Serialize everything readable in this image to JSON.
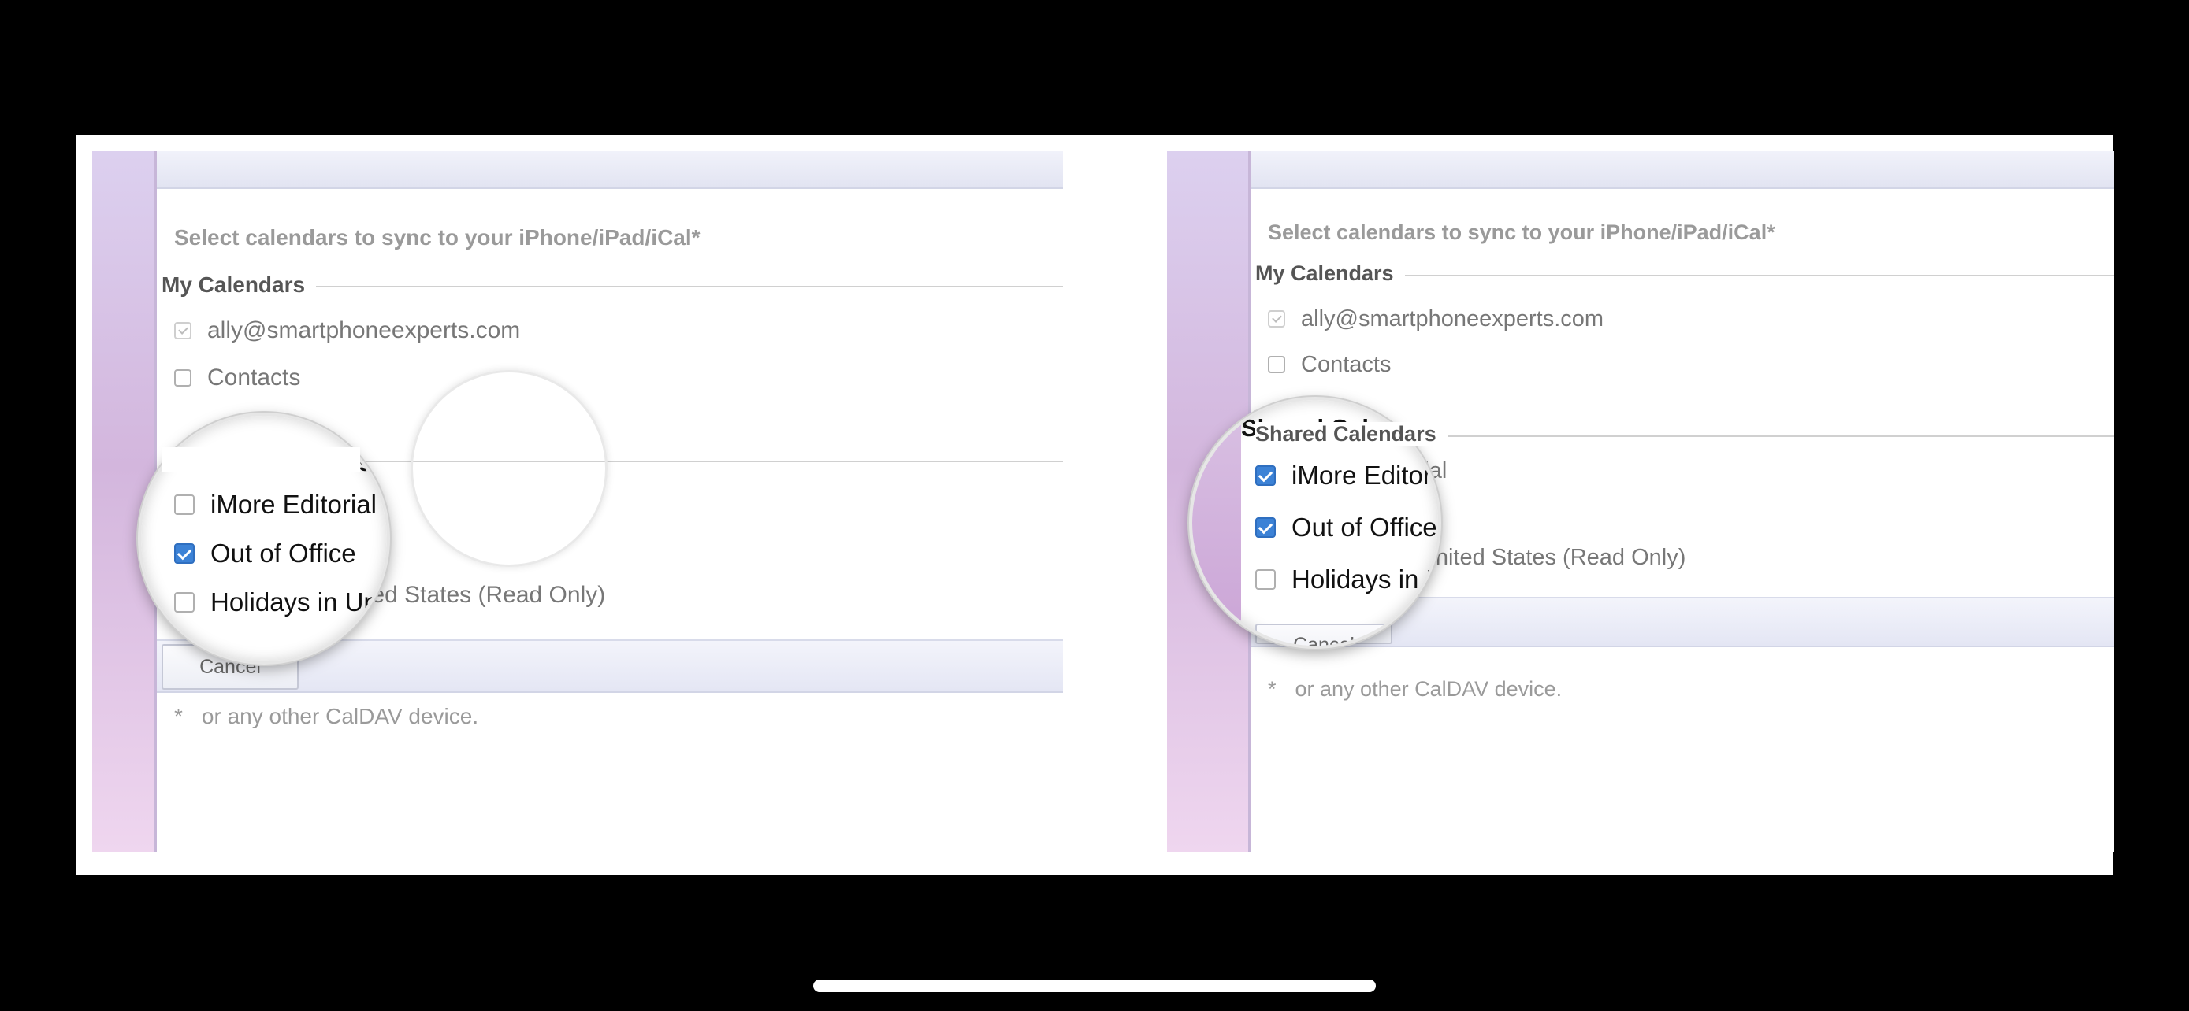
{
  "left_panel": {
    "title": "Select calendars to sync to your iPhone/iPad/iCal*",
    "my_calendars_label": "My Calendars",
    "account_label": "ally@smartphoneexperts.com",
    "contacts_label": "Contacts",
    "shared_calendars_label": "Shared Calendars",
    "shared_items": [
      {
        "label": "iMore Editorial",
        "checked": false
      },
      {
        "label": "Out of Office",
        "checked": true
      },
      {
        "label": "Holidays in United States (Read Only)",
        "checked": false
      }
    ],
    "cancel_label": "Cancel",
    "footnote_star": "*",
    "footnote_text": "or any other CalDAV device."
  },
  "right_panel": {
    "title": "Select calendars to sync to your iPhone/iPad/iCal*",
    "my_calendars_label": "My Calendars",
    "account_label": "ally@smartphoneexperts.com",
    "contacts_label": "Contacts",
    "shared_calendars_label": "Shared Calendars",
    "shared_items": [
      {
        "label": "iMore Editorial",
        "checked": true
      },
      {
        "label": "Out of Office",
        "checked": true
      },
      {
        "label": "Holidays in United States (Read Only)",
        "checked": false
      }
    ],
    "cancel_label": "Cancel",
    "footnote_star": "*",
    "footnote_text": "or any other CalDAV device."
  },
  "colors": {
    "checkbox_checked": "#3c82d6",
    "sidebar": "#d3b6dd",
    "background": "#000000"
  }
}
